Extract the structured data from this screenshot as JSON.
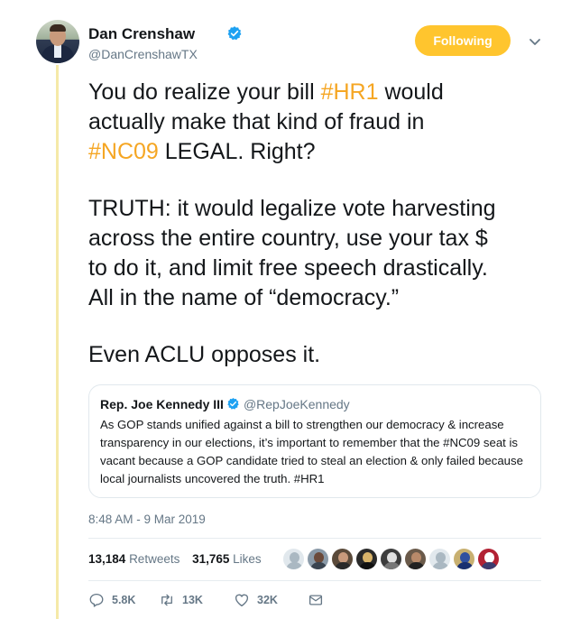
{
  "author": {
    "display_name": "Dan Crenshaw",
    "handle": "@DanCrenshawTX",
    "verified": true,
    "follow_label": "Following"
  },
  "tweet": {
    "line1_pre": "You do realize your bill ",
    "line1_tag": "#HR1",
    "line1_post": " would",
    "line2": "actually make that kind of fraud in",
    "line3_tag": "#NC09",
    "line3_post": " LEGAL. Right?",
    "para2_line1": "TRUTH: it would legalize vote harvesting",
    "para2_line2": "across the entire country, use your tax $",
    "para2_line3": "to do it, and limit free speech drastically.",
    "para2_line4": "All in the name of “democracy.”",
    "para3": "Even ACLU opposes it."
  },
  "quote": {
    "name": "Rep. Joe Kennedy III",
    "handle": "@RepJoeKennedy",
    "text": "As GOP stands unified against a bill to strengthen our democracy & increase transparency in our elections, it’s important to remember that the #NC09 seat is vacant because a GOP candidate tried to steal an election & only failed because local journalists uncovered the truth. #HR1"
  },
  "timestamp": "8:48 AM - 9 Mar 2019",
  "stats": {
    "retweets_count": "13,184",
    "retweets_label": "Retweets",
    "likes_count": "31,765",
    "likes_label": "Likes"
  },
  "actions": {
    "replies": "5.8K",
    "retweets": "13K",
    "likes": "32K"
  },
  "colors": {
    "accent": "#ffc52e",
    "hashtag": "#f5a623",
    "verified": "#1da1f2",
    "muted": "#657786"
  },
  "icons": [
    "verified-icon",
    "chevron-down-icon",
    "reply-icon",
    "retweet-icon",
    "heart-icon",
    "message-icon"
  ]
}
